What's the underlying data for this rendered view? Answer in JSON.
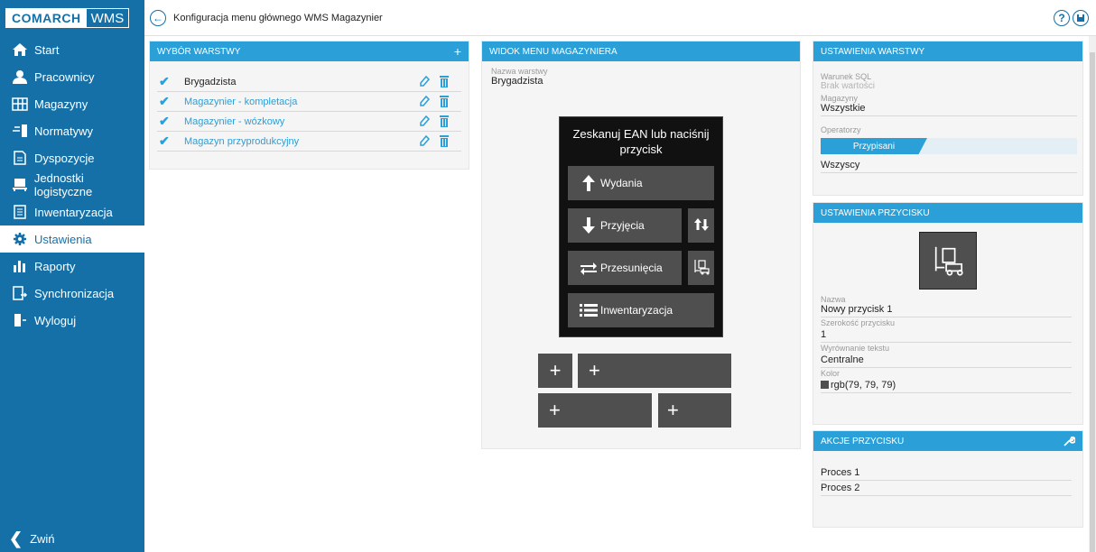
{
  "brand": {
    "company": "COMARCH",
    "product": "WMS"
  },
  "sidebar": {
    "items": [
      {
        "label": "Start",
        "icon": "home-icon"
      },
      {
        "label": "Pracownicy",
        "icon": "user-icon"
      },
      {
        "label": "Magazyny",
        "icon": "warehouse-icon"
      },
      {
        "label": "Normatywy",
        "icon": "norms-icon"
      },
      {
        "label": "Dyspozycje",
        "icon": "document-icon"
      },
      {
        "label": "Jednostki logistyczne",
        "icon": "pallet-icon"
      },
      {
        "label": "Inwentaryzacja",
        "icon": "clipboard-icon"
      },
      {
        "label": "Ustawienia",
        "icon": "gear-icon"
      },
      {
        "label": "Raporty",
        "icon": "chart-icon"
      },
      {
        "label": "Synchronizacja",
        "icon": "sync-icon"
      },
      {
        "label": "Wyloguj",
        "icon": "logout-icon"
      }
    ],
    "active_index": 7,
    "collapse_label": "Zwiń"
  },
  "topbar": {
    "title": "Konfiguracja menu głównego WMS Magazynier"
  },
  "layers_panel": {
    "title": "WYBÓR WARSTWY",
    "add_symbol": "+",
    "rows": [
      {
        "name": "Brygadzista",
        "selected": true
      },
      {
        "name": "Magazynier - kompletacja",
        "selected": false
      },
      {
        "name": "Magazynier - wózkowy",
        "selected": false
      },
      {
        "name": "Magazyn przyprodukcyjny",
        "selected": false
      }
    ]
  },
  "menu_view": {
    "title": "WIDOK MENU MAGAZYNIERA",
    "layer_name_label": "Nazwa warstwy",
    "layer_name_value": "Brygadzista",
    "device_title": "Zeskanuj EAN lub naciśnij przycisk",
    "buttons": {
      "wydania": "Wydania",
      "przyjecia": "Przyjęcia",
      "przesuniecia": "Przesunięcia",
      "inwentaryzacja": "Inwentaryzacja"
    },
    "plus_symbol": "+"
  },
  "layer_settings": {
    "title": "USTAWIENIA WARSTWY",
    "sql_label": "Warunek SQL",
    "sql_value": "Brak wartości",
    "warehouses_label": "Magazyny",
    "warehouses_value": "Wszystkie",
    "operators_label": "Operatorzy",
    "operators_tab": "Przypisani",
    "operators_value": "Wszyscy"
  },
  "button_settings": {
    "title": "USTAWIENIA PRZYCISKU",
    "name_label": "Nazwa",
    "name_value": "Nowy przycisk 1",
    "width_label": "Szerokość przycisku",
    "width_value": "1",
    "align_label": "Wyrównanie tekstu",
    "align_value": "Centralne",
    "color_label": "Kolor",
    "color_value": "rgb(79, 79, 79)"
  },
  "button_actions": {
    "title": "AKCJE PRZYCISKU",
    "items": [
      "Proces 1",
      "Proces 2"
    ]
  },
  "colors": {
    "sidebar": "#1670a8",
    "header": "#2a9fd8",
    "device": "#4f4f4f"
  }
}
